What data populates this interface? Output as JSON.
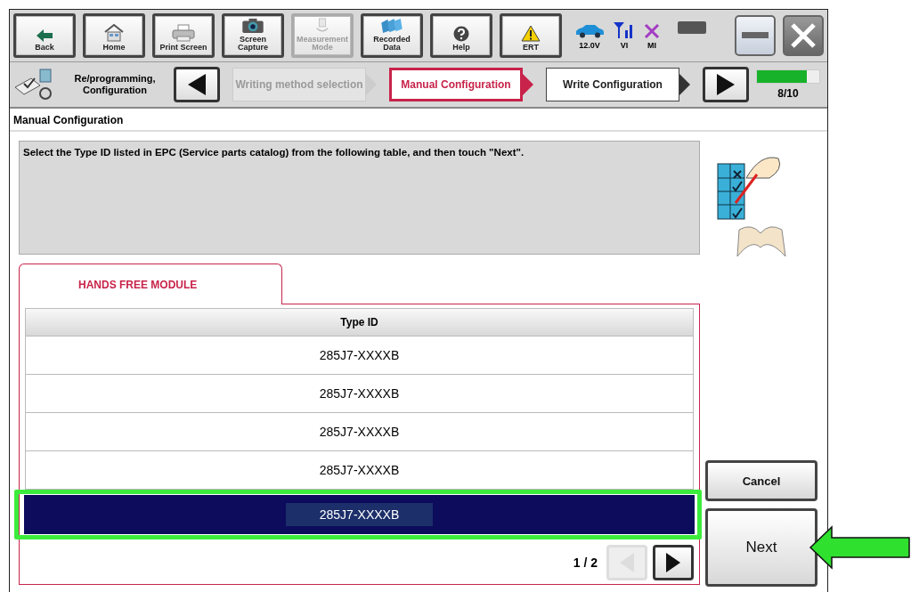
{
  "toolbar": {
    "buttons": [
      {
        "label": "Back",
        "disabled": false
      },
      {
        "label": "Home",
        "disabled": false
      },
      {
        "label": "Print Screen",
        "disabled": false
      },
      {
        "label": "Screen Capture",
        "disabled": false
      },
      {
        "label": "Measurement Mode",
        "disabled": true
      },
      {
        "label": "Recorded Data",
        "disabled": false
      },
      {
        "label": "Help",
        "disabled": false
      },
      {
        "label": "ERT",
        "disabled": false
      }
    ]
  },
  "status": [
    {
      "label": "12.0V"
    },
    {
      "label": "VI"
    },
    {
      "label": "MI"
    }
  ],
  "steps": {
    "section": "Re/programming, Configuration",
    "items": [
      {
        "label": "Writing method selection",
        "selected": false,
        "disabled": true
      },
      {
        "label": "Manual Configuration",
        "selected": true,
        "disabled": false
      },
      {
        "label": "Write Configuration",
        "selected": false,
        "disabled": false
      }
    ]
  },
  "progress": {
    "level": 0.8,
    "text": "8/10"
  },
  "page_title": "Manual Configuration",
  "message": "Select the Type ID listed in EPC (Service parts catalog) from the following table, and then touch \"Next\".",
  "tabs": [
    {
      "label": "HANDS FREE MODULE",
      "selected": true
    }
  ],
  "table": {
    "columns": [
      "Type ID"
    ],
    "rows": [
      {
        "cells": [
          "285J7-XXXXB"
        ],
        "selected": false,
        "highlighted": false
      },
      {
        "cells": [
          "285J7-XXXXB"
        ],
        "selected": false,
        "highlighted": false
      },
      {
        "cells": [
          "285J7-XXXXB"
        ],
        "selected": false,
        "highlighted": false
      },
      {
        "cells": [
          "285J7-XXXXB"
        ],
        "selected": false,
        "highlighted": false
      },
      {
        "cells": [
          "285J7-XXXXB"
        ],
        "selected": true,
        "highlighted": true
      }
    ]
  },
  "pager": {
    "text": "1 / 2",
    "prev_disabled": true,
    "next_disabled": false
  },
  "buttons": [
    {
      "label": "Cancel",
      "pointed": false
    },
    {
      "label": "Next",
      "pointed": true
    }
  ]
}
